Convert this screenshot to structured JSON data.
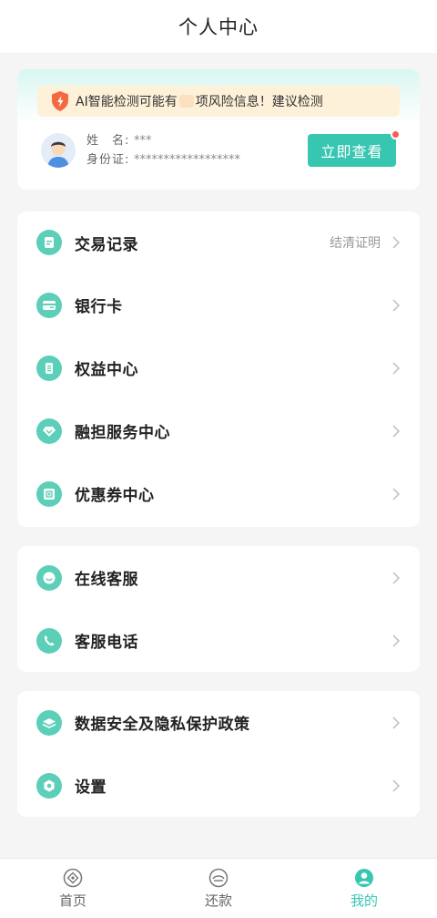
{
  "header": {
    "title": "个人中心"
  },
  "risk": {
    "notice_prefix": "AI智能检测可能有",
    "notice_suffix": "项风险信息！建议检测",
    "name_label": "姓　名:",
    "name_value": "***",
    "id_label": "身份证:",
    "id_value": "******************",
    "button_label": "立即查看"
  },
  "menu_group1": [
    {
      "label": "交易记录",
      "extra": "结清证明",
      "icon": "receipt-icon"
    },
    {
      "label": "银行卡",
      "extra": "",
      "icon": "bank-card-icon"
    },
    {
      "label": "权益中心",
      "extra": "",
      "icon": "benefits-icon"
    },
    {
      "label": "融担服务中心",
      "extra": "",
      "icon": "diamond-icon"
    },
    {
      "label": "优惠券中心",
      "extra": "",
      "icon": "coupon-icon"
    }
  ],
  "menu_group2": [
    {
      "label": "在线客服",
      "icon": "chat-icon"
    },
    {
      "label": "客服电话",
      "icon": "phone-icon"
    }
  ],
  "menu_group3": [
    {
      "label": "数据安全及隐私保护政策",
      "icon": "shield-layers-icon"
    },
    {
      "label": "设置",
      "icon": "gear-icon"
    }
  ],
  "tabs": [
    {
      "label": "首页",
      "icon": "home-icon"
    },
    {
      "label": "还款",
      "icon": "repay-icon"
    },
    {
      "label": "我的",
      "icon": "profile-icon"
    }
  ],
  "colors": {
    "accent": "#37c7b1",
    "icon_bg": "#5ccfb8",
    "notice_bg": "#fdf1d9",
    "badge": "#ff5a4e"
  }
}
